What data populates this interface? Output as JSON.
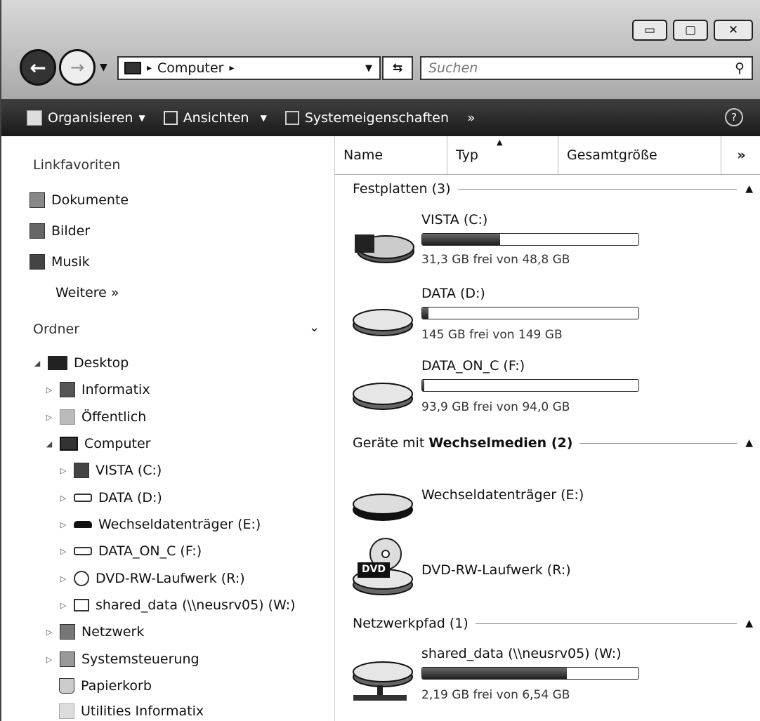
{
  "window": {
    "minimize": "▭",
    "maximize": "▢",
    "close": "✕"
  },
  "address": {
    "path": [
      "Computer"
    ],
    "separator": "▸"
  },
  "search": {
    "placeholder": "Suchen"
  },
  "toolbar": {
    "organize": "Organisieren",
    "views": "Ansichten",
    "system_props": "Systemeigenschaften",
    "more": "»",
    "help": "?"
  },
  "sidebar": {
    "favorites_header": "Linkfavoriten",
    "favorites": [
      "Dokumente",
      "Bilder",
      "Musik"
    ],
    "more": "Weitere  »",
    "folders_header": "Ordner",
    "tree": {
      "desktop": "Desktop",
      "informatix": "Informatix",
      "public": "Öffentlich",
      "computer": "Computer",
      "vista": "VISTA (C:)",
      "data": "DATA (D:)",
      "removable": "Wechseldatenträger (E:)",
      "data_on_c": "DATA_ON_C (F:)",
      "dvd": "DVD-RW-Laufwerk (R:)",
      "shared": "shared_data (\\\\neusrv05) (W:)",
      "network": "Netzwerk",
      "control": "Systemsteuerung",
      "trash": "Papierkorb",
      "utilities": "Utilities Informatix"
    }
  },
  "columns": {
    "name": "Name",
    "type": "Typ",
    "total": "Gesamtgröße",
    "more": "»"
  },
  "groups": {
    "hdd": "Festplatten (3)",
    "removable_prefix": "Geräte mit ",
    "removable_bold": "Wechselmedien (2)",
    "network": "Netzwerkpfad (1)"
  },
  "drives": {
    "vista": {
      "name": "VISTA (C:)",
      "free": "31,3 GB frei von 48,8 GB",
      "used_fraction": 0.36
    },
    "data": {
      "name": "DATA (D:)",
      "free": "145 GB frei von 149 GB",
      "used_fraction": 0.03
    },
    "data_on_c": {
      "name": "DATA_ON_C (F:)",
      "free": "93,9 GB frei von 94,0 GB",
      "used_fraction": 0.01
    },
    "removable": {
      "name": "Wechseldatenträger (E:)"
    },
    "dvd": {
      "name": "DVD-RW-Laufwerk (R:)",
      "badge": "DVD"
    },
    "shared": {
      "name": "shared_data (\\\\neusrv05) (W:)",
      "free": "2,19 GB frei von 6,54 GB",
      "used_fraction": 0.67
    }
  }
}
